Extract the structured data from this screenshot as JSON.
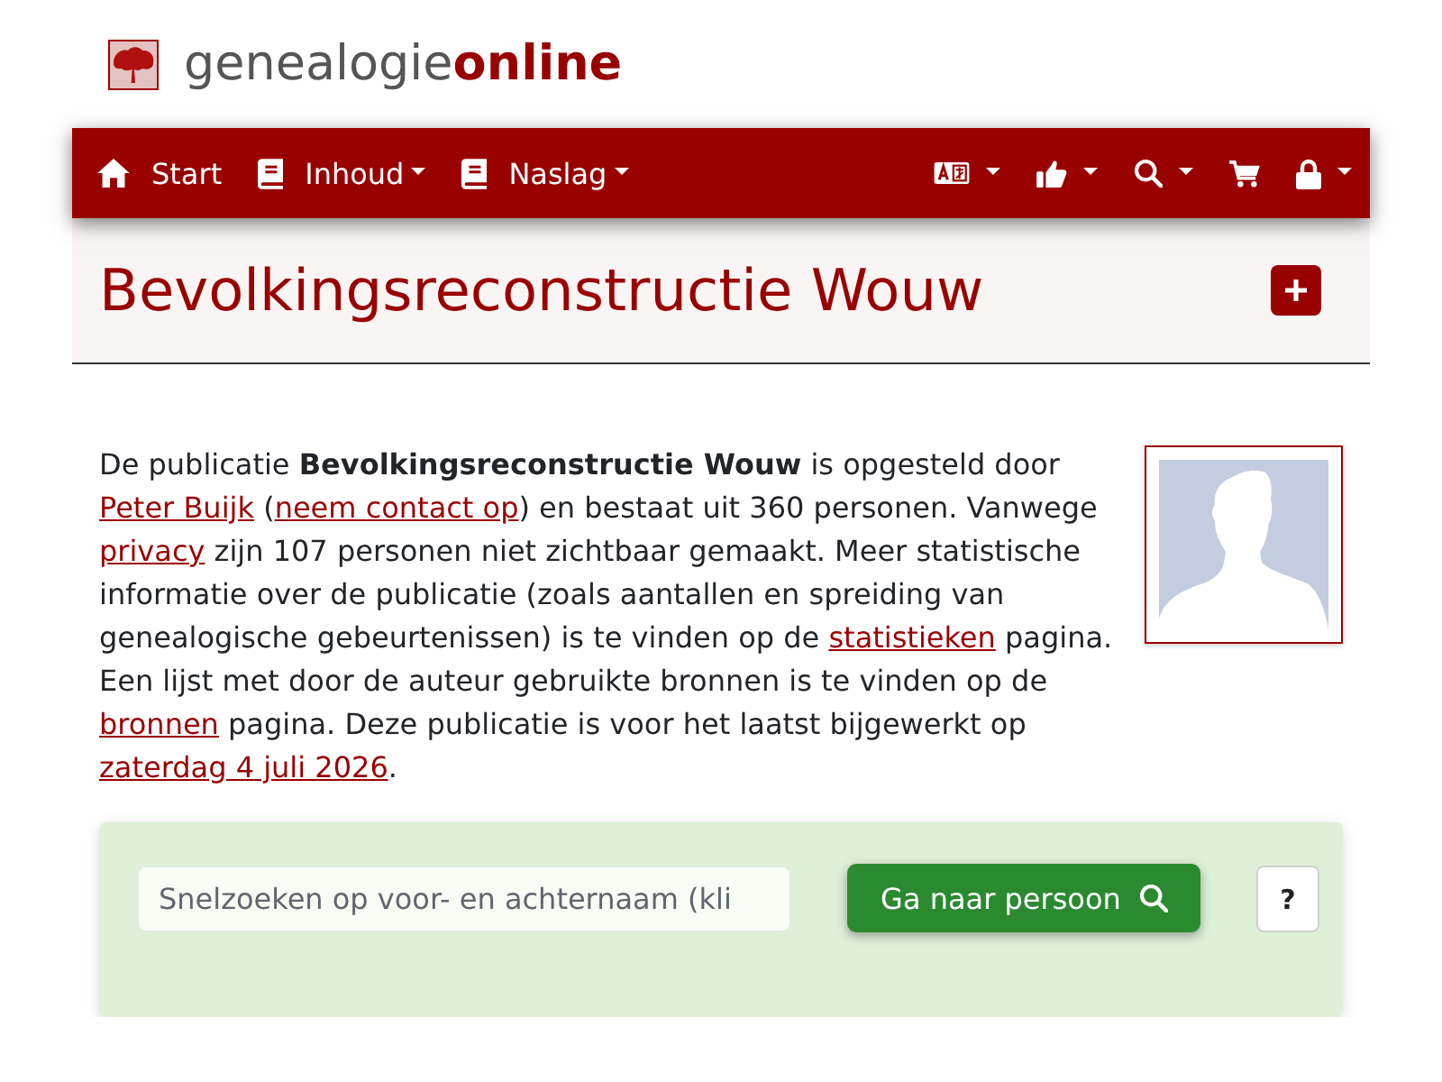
{
  "logo": {
    "text": "genealogie**online**"
  },
  "navbar": {
    "items": [
      {
        "kind": "home",
        "label": "Start",
        "dropdown": false
      },
      {
        "kind": "book",
        "label": "Inhoud",
        "dropdown": true
      },
      {
        "kind": "book",
        "label": "Naslag",
        "dropdown": true
      }
    ],
    "actions": [
      {
        "kind": "language",
        "dropdown": true
      },
      {
        "kind": "like",
        "dropdown": true
      },
      {
        "kind": "search",
        "dropdown": true
      },
      {
        "kind": "cart",
        "dropdown": false
      },
      {
        "kind": "account",
        "dropdown": true
      }
    ]
  },
  "page": {
    "title": "Bevolkingsreconstructie Wouw"
  },
  "intro": {
    "segments": [
      {
        "kind": "text",
        "text": "De publicatie **Bevolkingsreconstructie Wouw** is opgesteld door "
      },
      {
        "kind": "link",
        "text": "Peter Buijk"
      },
      {
        "kind": "text",
        "text": " ("
      },
      {
        "kind": "link",
        "text": "neem contact op"
      },
      {
        "kind": "text",
        "text": ") en bestaat uit 360 personen. Vanwege "
      },
      {
        "kind": "link",
        "text": "privacy"
      },
      {
        "kind": "text",
        "text": " zijn 107 personen niet zichtbaar gemaakt. Meer statistische informatie over de publicatie (zoals aantallen en spreiding van genealogische gebeurtenissen) is te vinden op de "
      },
      {
        "kind": "link",
        "text": "statistieken"
      },
      {
        "kind": "text",
        "text": " pagina. Een lijst met door de auteur gebruikte bronnen is te vinden op de "
      },
      {
        "kind": "link",
        "text": "bronnen"
      },
      {
        "kind": "text",
        "text": " pagina. Deze publicatie is voor het laatst bijgewerkt op "
      },
      {
        "kind": "link",
        "text": "zaterdag 4 juli 2026"
      },
      {
        "kind": "text",
        "text": "."
      }
    ]
  },
  "quick_search": {
    "placeholder": "Snelzoeken op voor- en achternaam (kli",
    "button": "Ga naar persoon",
    "help": "?"
  }
}
